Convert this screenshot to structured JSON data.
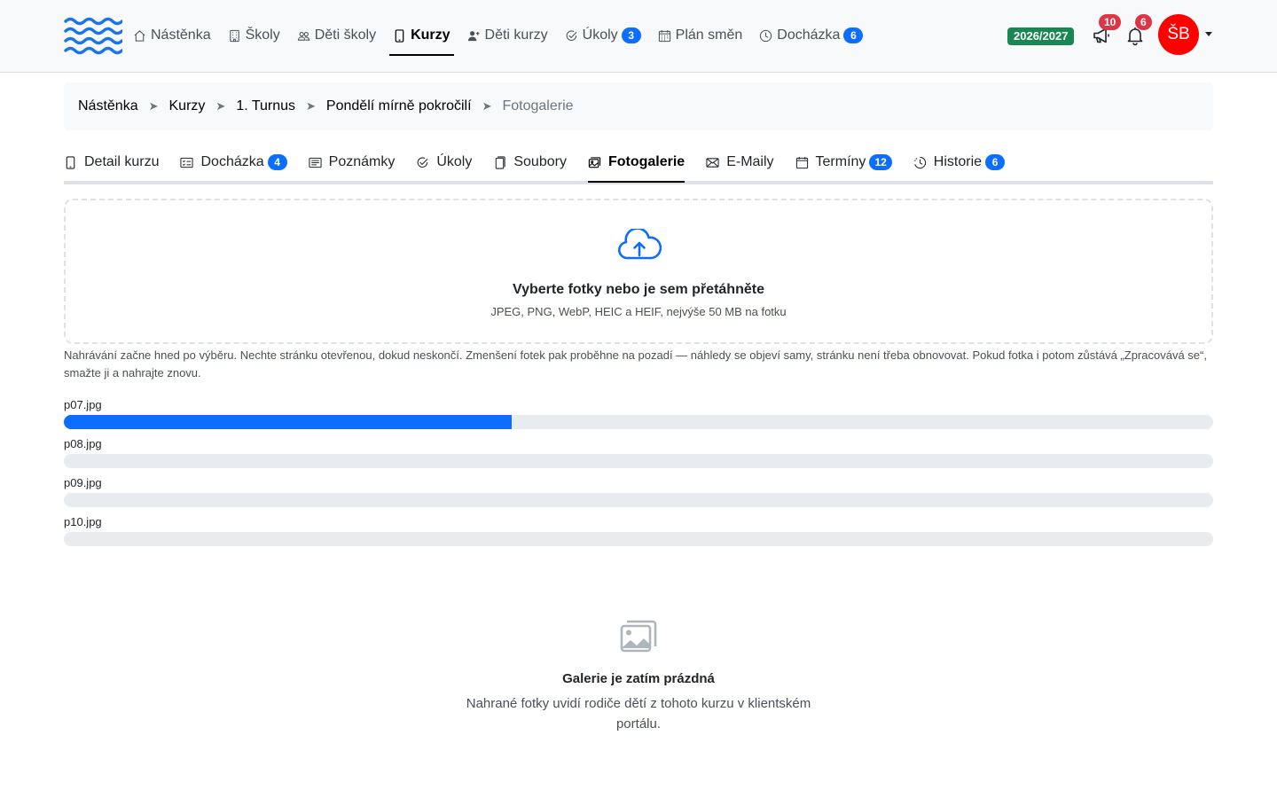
{
  "nav": {
    "items": [
      {
        "label": "Nástěnka",
        "icon": "home-icon"
      },
      {
        "label": "Školy",
        "icon": "building-icon"
      },
      {
        "label": "Děti školy",
        "icon": "people-icon"
      },
      {
        "label": "Kurzy",
        "icon": "tablet-icon",
        "active": true
      },
      {
        "label": "Děti kurzy",
        "icon": "person-plus-icon"
      },
      {
        "label": "Úkoly",
        "icon": "check-circle-icon",
        "badge": "3"
      },
      {
        "label": "Plán směn",
        "icon": "calendar-grid-icon"
      },
      {
        "label": "Docházka",
        "icon": "clock-icon",
        "badge": "6"
      }
    ],
    "year": "2026/2027",
    "announcements_count": "10",
    "notifications_count": "6",
    "avatar_initials": "ŠB"
  },
  "breadcrumb": [
    {
      "label": "Nástěnka"
    },
    {
      "label": "Kurzy"
    },
    {
      "label": "1. Turnus"
    },
    {
      "label": "Pondělí mírně pokročilí"
    },
    {
      "label": "Fotogalerie"
    }
  ],
  "tabs": [
    {
      "label": "Detail kurzu",
      "icon": "tablet-icon"
    },
    {
      "label": "Docházka",
      "icon": "card-checklist-icon",
      "badge": "4"
    },
    {
      "label": "Poznámky",
      "icon": "card-text-icon"
    },
    {
      "label": "Úkoly",
      "icon": "check-circle-icon"
    },
    {
      "label": "Soubory",
      "icon": "files-icon"
    },
    {
      "label": "Fotogalerie",
      "icon": "images-icon",
      "active": true
    },
    {
      "label": "E-Maily",
      "icon": "envelope-icon"
    },
    {
      "label": "Termíny",
      "icon": "calendar-icon",
      "badge": "12"
    },
    {
      "label": "Historie",
      "icon": "clock-history-icon",
      "badge": "6"
    }
  ],
  "dropzone": {
    "title": "Vyberte fotky nebo je sem přetáhněte",
    "subtitle": "JPEG, PNG, WebP, HEIC a HEIF, nejvýše 50 MB na fotku"
  },
  "upload_note": "Nahrávání začne hned po výběru. Nechte stránku otevřenou, dokud neskončí. Zmenšení fotek pak proběhne na pozadí — náhledy se objeví samy, stránku není třeba obnovovat. Pokud fotka i potom zůstává „Zpracovává se“, smažte ji a nahrajte znovu.",
  "uploads": [
    {
      "file": "p07.jpg",
      "progress": 0.39
    },
    {
      "file": "p08.jpg",
      "progress": 0
    },
    {
      "file": "p09.jpg",
      "progress": 0
    },
    {
      "file": "p10.jpg",
      "progress": 0
    }
  ],
  "empty_gallery": {
    "title": "Galerie je zatím prázdná",
    "text": "Nahrané fotky uvidí rodiče dětí z tohoto kurzu v klientském portálu."
  },
  "colors": {
    "accent": "#0d6efd",
    "logo": "#1a73e8",
    "year_badge": "#198754",
    "alert": "#dc3545",
    "avatar": "#ff0000"
  }
}
